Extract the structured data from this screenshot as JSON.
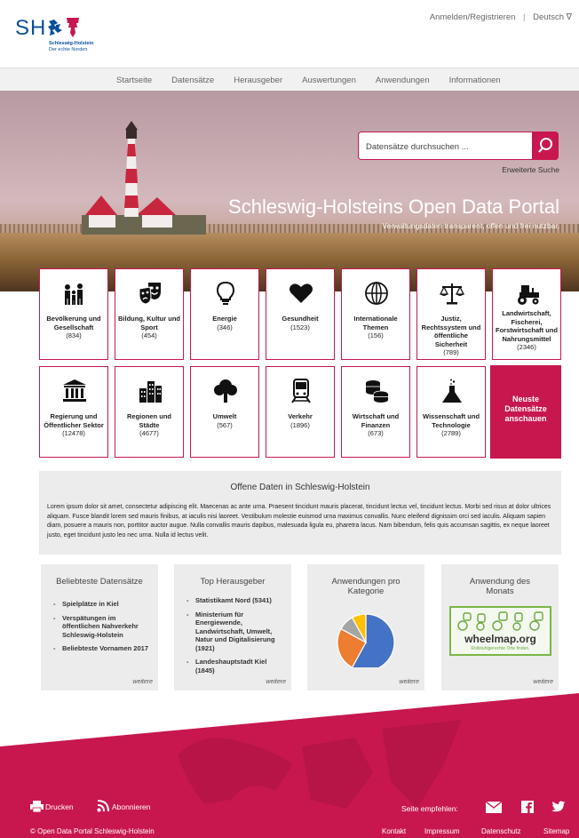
{
  "header": {
    "logo_sh": "SH",
    "logo_line1": "Schleswig-Holstein",
    "logo_line2": "Der echte Norden",
    "login": "Anmelden/Registrieren",
    "separator": "|",
    "language": "Deutsch ∇"
  },
  "nav": {
    "items": [
      "Startseite",
      "Datensätze",
      "Herausgeber",
      "Auswertungen",
      "Anwendungen",
      "Informationen"
    ]
  },
  "hero": {
    "search_placeholder": "Datensätze durchsuchen ...",
    "advanced_search": "Erweiterte Suche",
    "title": "Schleswig-Holsteins Open Data Portal",
    "subtitle": "Verwaltungsdaten transparent, offen und frei nutzbar."
  },
  "categories": [
    {
      "label": "Bevölkerung und Gesellschaft",
      "count": "(834)",
      "icon": "people-icon"
    },
    {
      "label": "Bildung, Kultur und Sport",
      "count": "(454)",
      "icon": "theater-masks-icon"
    },
    {
      "label": "Energie",
      "count": "(346)",
      "icon": "lightbulb-icon"
    },
    {
      "label": "Gesundheit",
      "count": "(1523)",
      "icon": "heart-icon"
    },
    {
      "label": "Internationale Themen",
      "count": "(156)",
      "icon": "globe-icon"
    },
    {
      "label": "Justiz, Rechtssystem und öffentliche Sicherheit",
      "count": "(789)",
      "icon": "scales-icon"
    },
    {
      "label": "Landwirtschaft, Fischerei, Forstwirtschaft und Nahrungsmittel",
      "count": "(2346)",
      "icon": "tractor-icon"
    },
    {
      "label": "Regierung und Öffentlicher Sektor",
      "count": "(12478)",
      "icon": "government-building-icon"
    },
    {
      "label": "Regionen und Städte",
      "count": "(4677)",
      "icon": "city-icon"
    },
    {
      "label": "Umwelt",
      "count": "(567)",
      "icon": "tree-icon"
    },
    {
      "label": "Verkehr",
      "count": "(1896)",
      "icon": "train-icon"
    },
    {
      "label": "Wirtschaft und Finanzen",
      "count": "(673)",
      "icon": "coins-icon"
    },
    {
      "label": "Wissenschaft und Technologie",
      "count": "(2789)",
      "icon": "flask-icon"
    }
  ],
  "newest": "Neuste Datensätze anschauen",
  "intro": {
    "title": "Offene Daten in Schleswig-Holstein",
    "text": "Lorem ipsum dolor sit amet, consectetur adipiscing elit. Maecenas ac ante urna. Praesent tincidunt mauris placerat, tincidunt lectus vel, tincidunt lectus. Morbi sed risus at dolor ultrices aliquam. Fusce blandit lorem sed mauris finibus, at iaculis nisi laoreet. Vestibulum molestie euismod urna maximus convallis. Nunc eleifend dignissim orci sed iaculis. Aliquam sapien diam, posuere a mauris non, porttitor auctor augue. Nulla convallis mauris dapibus, malesuada ligula eu, pharetra lacus. Nam bibendum, felis quis accumsan sagittis, ex neque laoreet justo, eget tincidunt justo leo nec urna. Nulla id lectus velit."
  },
  "cards": {
    "popular": {
      "title": "Beliebteste Datensätze",
      "items": [
        "Spielplätze in Kiel",
        "Verspätungen im öffentlichen Nahverkehr Schleswig-Holstein",
        "Beliebteste Vornamen 2017"
      ],
      "more": "weitere"
    },
    "publishers": {
      "title": "Top Herausgeber",
      "items": [
        "Statistikamt Nord (5341)",
        "Ministerium für Energiewende, Landwirtschaft, Umwelt, Natur und Digitalisierung (1921)",
        "Landeshauptstadt Kiel (1845)"
      ],
      "more": "weitere"
    },
    "apps_per_category": {
      "title": "Anwendungen pro Kategorie",
      "more": "weitere",
      "pie_colors": [
        "#4472c4",
        "#ed7d31",
        "#a5a5a5",
        "#ffc000"
      ],
      "pie_shares": [
        0.58,
        0.25,
        0.09,
        0.08
      ]
    },
    "app_of_month": {
      "title": "Anwendung des Monats",
      "app_name": "wheelmap.org",
      "app_tagline": "Rollstuhlgerechte Orte finden.",
      "more": "weitere"
    }
  },
  "footer": {
    "print": "Drucken",
    "subscribe": "Abonnieren",
    "recommend": "Seite empfehlen:",
    "copyright": "© Open Data Portal Schleswig-Holstein",
    "contact": "Kontakt",
    "imprint": "Impressum",
    "privacy": "Datenschutz",
    "sitemap": "Sitemap"
  },
  "colors": {
    "accent": "#c8174f",
    "brand_blue": "#0b4f9c",
    "panel_grey": "#ececec"
  }
}
